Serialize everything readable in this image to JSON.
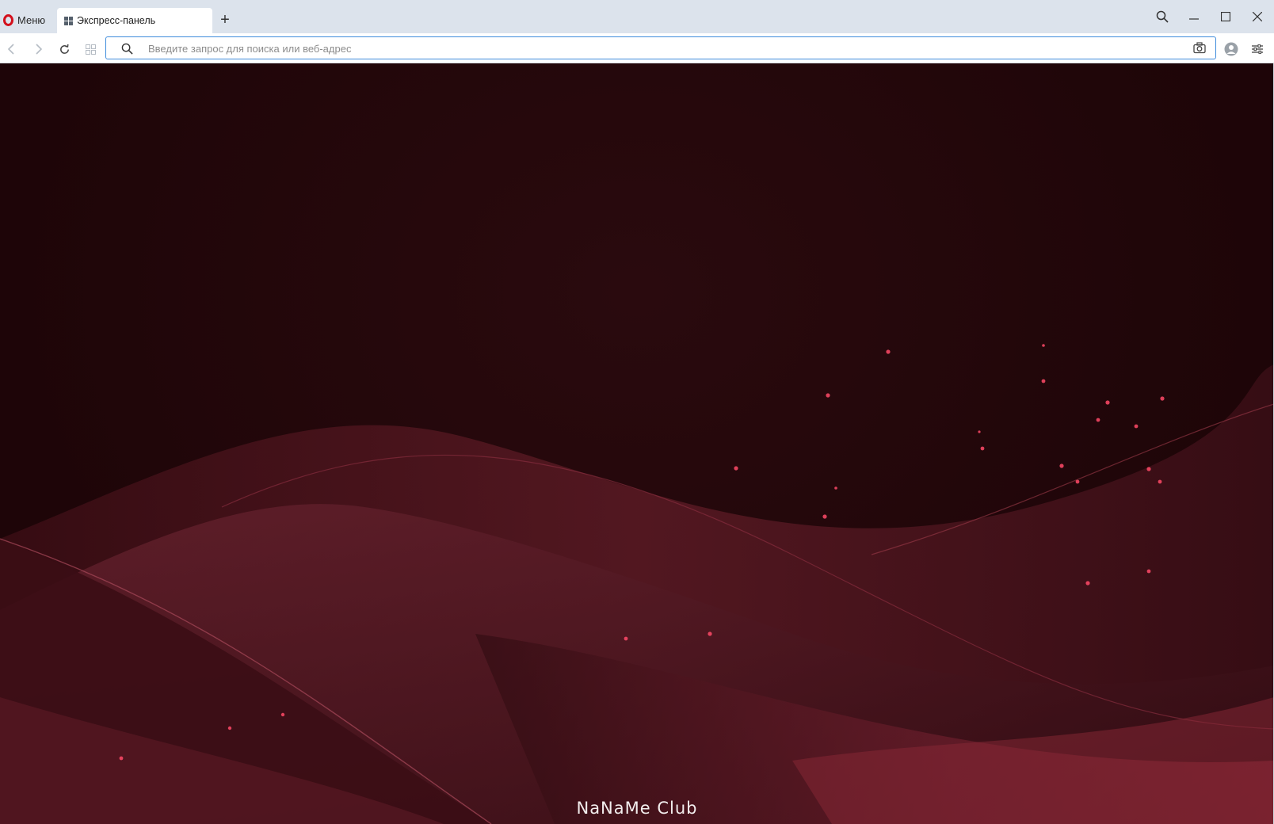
{
  "browser": {
    "menu_label": "Меню",
    "tab": {
      "title": "Экспресс-панель"
    },
    "new_tab_symbol": "+",
    "address_bar": {
      "value": "",
      "placeholder": "Введите запрос для поиска или веб-адрес"
    }
  },
  "wallpaper": {
    "brand_text": "NaNaMe Club",
    "colors": {
      "background": "#200609",
      "wave": "#7a1e2c",
      "particles": "#ff4a68"
    }
  },
  "icons": {
    "search": "search-icon",
    "minimize": "minimize-icon",
    "maximize": "maximize-icon",
    "close": "close-icon",
    "back": "back-arrow-icon",
    "forward": "forward-arrow-icon",
    "reload": "reload-icon",
    "speed_dial": "speed-dial-grid-icon",
    "snapshot": "camera-icon",
    "account": "account-icon",
    "easy_setup": "easy-setup-icon"
  }
}
